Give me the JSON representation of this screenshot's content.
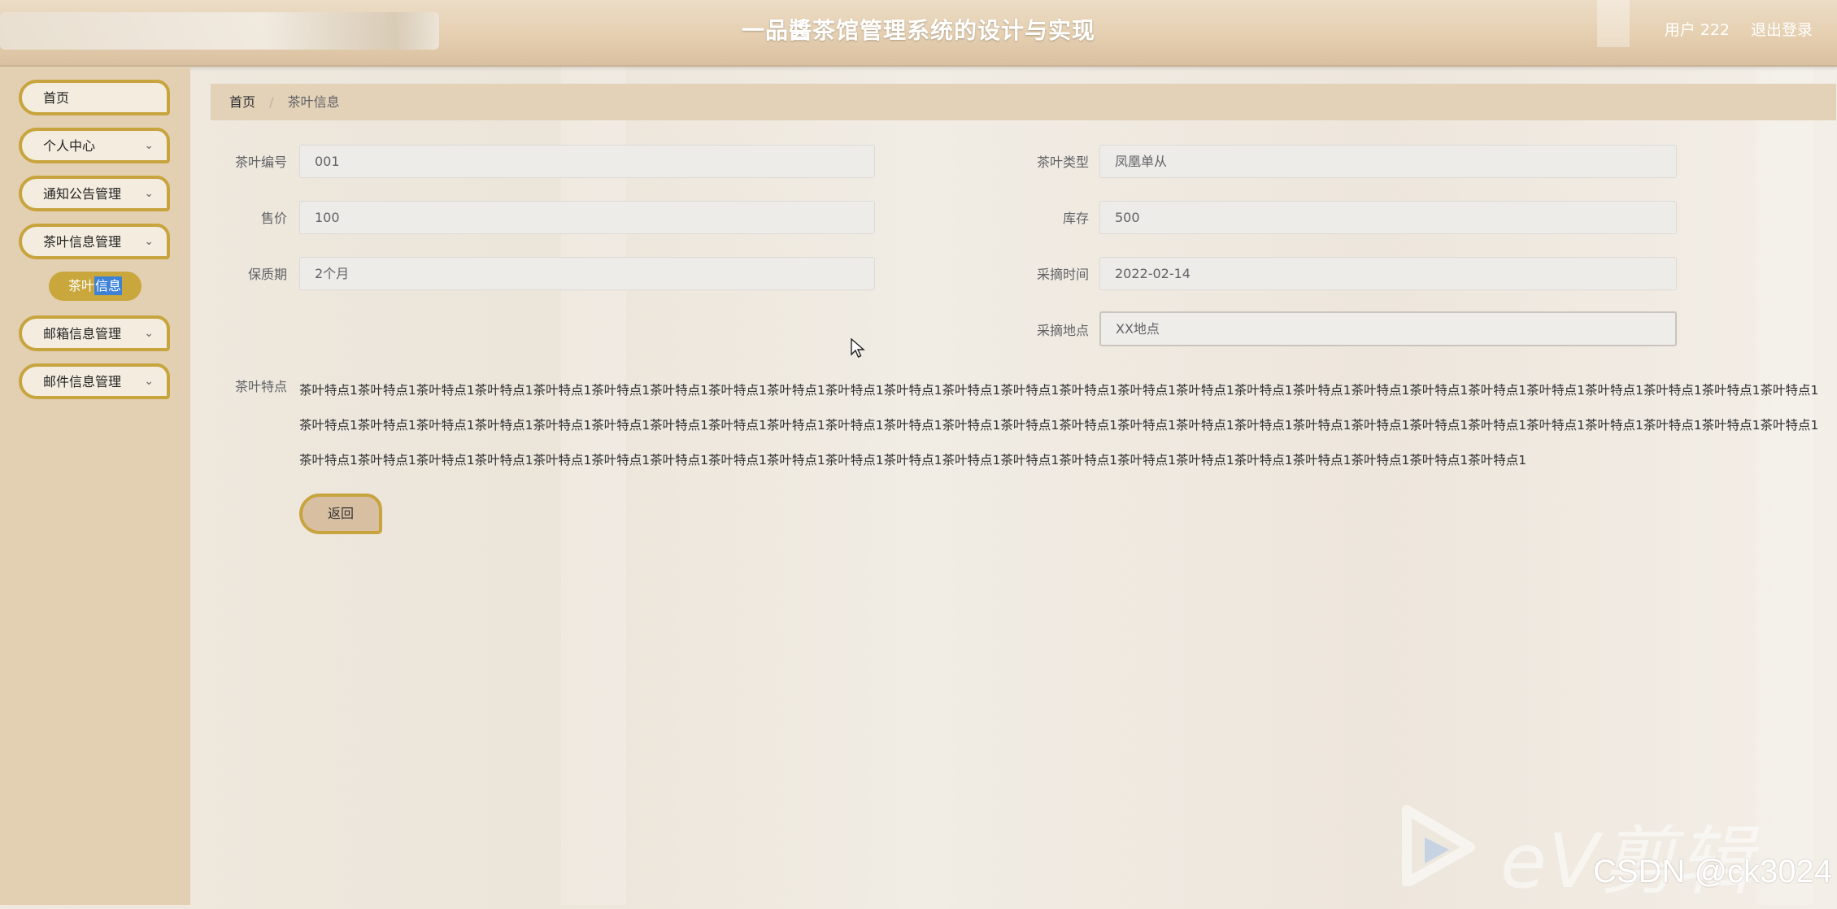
{
  "header": {
    "title": "一品醬茶馆管理系统的设计与实现",
    "user": "用户 222",
    "logout": "退出登录"
  },
  "sidebar": {
    "items": [
      {
        "label": "首页",
        "has_chevron": false
      },
      {
        "label": "个人中心",
        "has_chevron": true
      },
      {
        "label": "通知公告管理",
        "has_chevron": true
      },
      {
        "label": "茶叶信息管理",
        "has_chevron": true
      },
      {
        "label": "邮箱信息管理",
        "has_chevron": true
      },
      {
        "label": "邮件信息管理",
        "has_chevron": true
      }
    ],
    "submenu": {
      "label_a": "茶叶",
      "label_b": "信息"
    },
    "chevron": "⌄"
  },
  "breadcrumb": {
    "home": "首页",
    "separator": "/",
    "current": "茶叶信息"
  },
  "form": {
    "tea_no": {
      "label": "茶叶编号",
      "value": "001"
    },
    "tea_type": {
      "label": "茶叶类型",
      "value": "凤凰单从"
    },
    "price": {
      "label": "售价",
      "value": "100"
    },
    "stock": {
      "label": "库存",
      "value": "500"
    },
    "shelf_life": {
      "label": "保质期",
      "value": "2个月"
    },
    "pick_time": {
      "label": "采摘时间",
      "value": "2022-02-14"
    },
    "pick_place": {
      "label": "采摘地点",
      "value": "XX地点"
    },
    "features": {
      "label": "茶叶特点",
      "value": "茶叶特点1茶叶特点1茶叶特点1茶叶特点1茶叶特点1茶叶特点1茶叶特点1茶叶特点1茶叶特点1茶叶特点1茶叶特点1茶叶特点1茶叶特点1茶叶特点1茶叶特点1茶叶特点1茶叶特点1茶叶特点1茶叶特点1茶叶特点1茶叶特点1茶叶特点1茶叶特点1茶叶特点1茶叶特点1茶叶特点1茶叶特点1茶叶特点1茶叶特点1茶叶特点1茶叶特点1茶叶特点1茶叶特点1茶叶特点1茶叶特点1茶叶特点1茶叶特点1茶叶特点1茶叶特点1茶叶特点1茶叶特点1茶叶特点1茶叶特点1茶叶特点1茶叶特点1茶叶特点1茶叶特点1茶叶特点1茶叶特点1茶叶特点1茶叶特点1茶叶特点1茶叶特点1茶叶特点1茶叶特点1茶叶特点1茶叶特点1茶叶特点1茶叶特点1茶叶特点1茶叶特点1茶叶特点1茶叶特点1茶叶特点1茶叶特点1茶叶特点1茶叶特点1茶叶特点1茶叶特点1茶叶特点1茶叶特点1茶叶特点1茶叶特点1"
    }
  },
  "back_button": "返回",
  "watermark": {
    "brand": "eV剪辑",
    "csdn": "CSDN @ck3024"
  },
  "colors": {
    "accent": "#c8a43e",
    "header": "#e5cfb0",
    "sidebar": "#e3cfb2",
    "highlight": "#3d82d6"
  }
}
